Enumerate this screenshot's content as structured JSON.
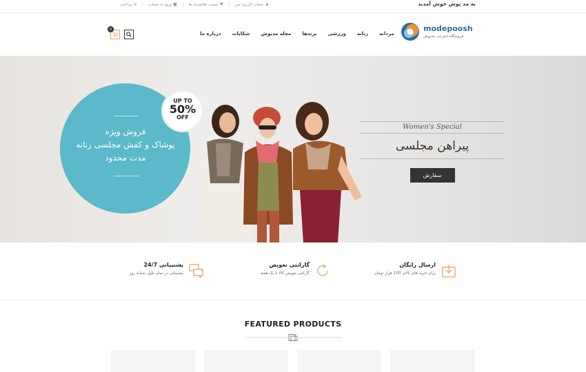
{
  "topbar": {
    "welcome": "به مد پوش خوش آمدید",
    "links": [
      {
        "label": "حساب کاربری من",
        "icon": "user-icon"
      },
      {
        "label": "لیست علاقمندی ها",
        "icon": "heart-icon"
      },
      {
        "label": "ورود به حساب",
        "icon": "lock-icon"
      },
      {
        "label": "پرداخت",
        "icon": "checkout-icon"
      }
    ]
  },
  "header": {
    "logo_name": "modepoosh",
    "logo_tagline": "فروشگاه اینترنتی مدپوش",
    "nav": [
      "مردانه",
      "زنانه",
      "ورزشی",
      "برندها",
      "مجله مدپوش",
      "شکایات",
      "درباره ما"
    ],
    "cart_count": "0",
    "colors": {
      "logo_blue": "#2d6e9b",
      "logo_orange": "#e8952a",
      "accent": "#5bb9c9"
    }
  },
  "hero": {
    "circle_lines": [
      "فروش ویژه",
      "پوشاک و کفش مجلسی زنانه",
      "مدت محدود"
    ],
    "badge_top": "UP TO",
    "badge_value": "50%",
    "badge_bottom": "OFF",
    "special_en": "Women's Special",
    "special_fa": "پیراهن مجلسی",
    "order_button": "سفارش"
  },
  "features": [
    {
      "title": "ارسال رایگان",
      "desc": "برای خرید های بالای 100 هزار تومان",
      "icon": "download-box-icon"
    },
    {
      "title": "گارانتی تعویض",
      "desc": "گارانتی تعویض کالا تا یک هفته",
      "icon": "refresh-icon"
    },
    {
      "title": "پشتیبانی 24/7",
      "desc": "پشتیبانی در تمام طول شبانه روز",
      "icon": "chat-icon"
    }
  ],
  "featured": {
    "title": "FEATURED PRODUCTS"
  }
}
